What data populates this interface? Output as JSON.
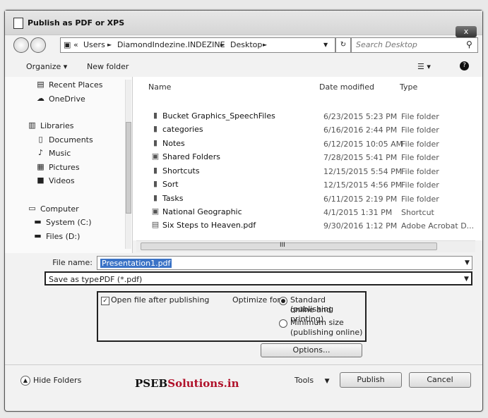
{
  "window": {
    "title": "Publish as PDF or XPS",
    "close_label": "x"
  },
  "address": {
    "prefix": "«",
    "crumbs": [
      "Users",
      "DiamondIndezine.INDEZINE",
      "Desktop"
    ],
    "separator": "►"
  },
  "search": {
    "placeholder": "Search Desktop"
  },
  "toolbar": {
    "organize_label": "Organize ▾",
    "new_folder_label": "New folder"
  },
  "sidebar": {
    "items": [
      {
        "label": "Recent Places",
        "icon": "recent-places-icon"
      },
      {
        "label": "OneDrive",
        "icon": "onedrive-icon"
      },
      {
        "label": "Libraries",
        "icon": "libraries-icon"
      },
      {
        "label": "Documents",
        "icon": "documents-icon"
      },
      {
        "label": "Music",
        "icon": "music-icon"
      },
      {
        "label": "Pictures",
        "icon": "pictures-icon"
      },
      {
        "label": "Videos",
        "icon": "videos-icon"
      },
      {
        "label": "Computer",
        "icon": "computer-icon"
      },
      {
        "label": "System (C:)",
        "icon": "drive-icon"
      },
      {
        "label": "Files (D:)",
        "icon": "drive-icon"
      }
    ]
  },
  "columns": {
    "name": "Name",
    "date": "Date modified",
    "type": "Type"
  },
  "files": [
    {
      "name": "Bucket Graphics_SpeechFiles",
      "date": "6/23/2015 5:23 PM",
      "type": "File folder",
      "icon": "folder-icon"
    },
    {
      "name": "categories",
      "date": "6/16/2016 2:44 PM",
      "type": "File folder",
      "icon": "folder-icon"
    },
    {
      "name": "Notes",
      "date": "6/12/2015 10:05 AM",
      "type": "File folder",
      "icon": "folder-icon"
    },
    {
      "name": "Shared Folders",
      "date": "7/28/2015 5:41 PM",
      "type": "File folder",
      "icon": "shared-folder-icon"
    },
    {
      "name": "Shortcuts",
      "date": "12/15/2015 5:54 PM",
      "type": "File folder",
      "icon": "folder-icon"
    },
    {
      "name": "Sort",
      "date": "12/15/2015 4:56 PM",
      "type": "File folder",
      "icon": "folder-icon"
    },
    {
      "name": "Tasks",
      "date": "6/11/2015 2:19 PM",
      "type": "File folder",
      "icon": "folder-icon"
    },
    {
      "name": "National Geographic",
      "date": "4/1/2015 1:31 PM",
      "type": "Shortcut",
      "icon": "shortcut-icon"
    },
    {
      "name": "Six Steps to Heaven.pdf",
      "date": "9/30/2016 1:12 PM",
      "type": "Adobe Acrobat D...",
      "icon": "pdf-file-icon"
    }
  ],
  "scroll_marker": "III",
  "form": {
    "filename_label": "File name:",
    "filename_value": "Presentation1.pdf",
    "savetype_label": "Save as type:",
    "savetype_value": "PDF (*.pdf)"
  },
  "options": {
    "open_after_label": "Open file after publishing",
    "open_after_checked": true,
    "optimize_label": "Optimize for:",
    "standard_label": "Standard (publishing online and printing)",
    "standard_line1": "Standard (publishing",
    "standard_line2": "online and printing)",
    "minimum_line1": "Minimum size",
    "minimum_line2": "(publishing online)",
    "selected": "standard",
    "options_button": "Options..."
  },
  "footer": {
    "hide_folders": "Hide Folders",
    "tools": "Tools",
    "publish": "Publish",
    "cancel": "Cancel"
  },
  "watermark": {
    "part1": "PSEB",
    "part2": "Solutions.in"
  }
}
